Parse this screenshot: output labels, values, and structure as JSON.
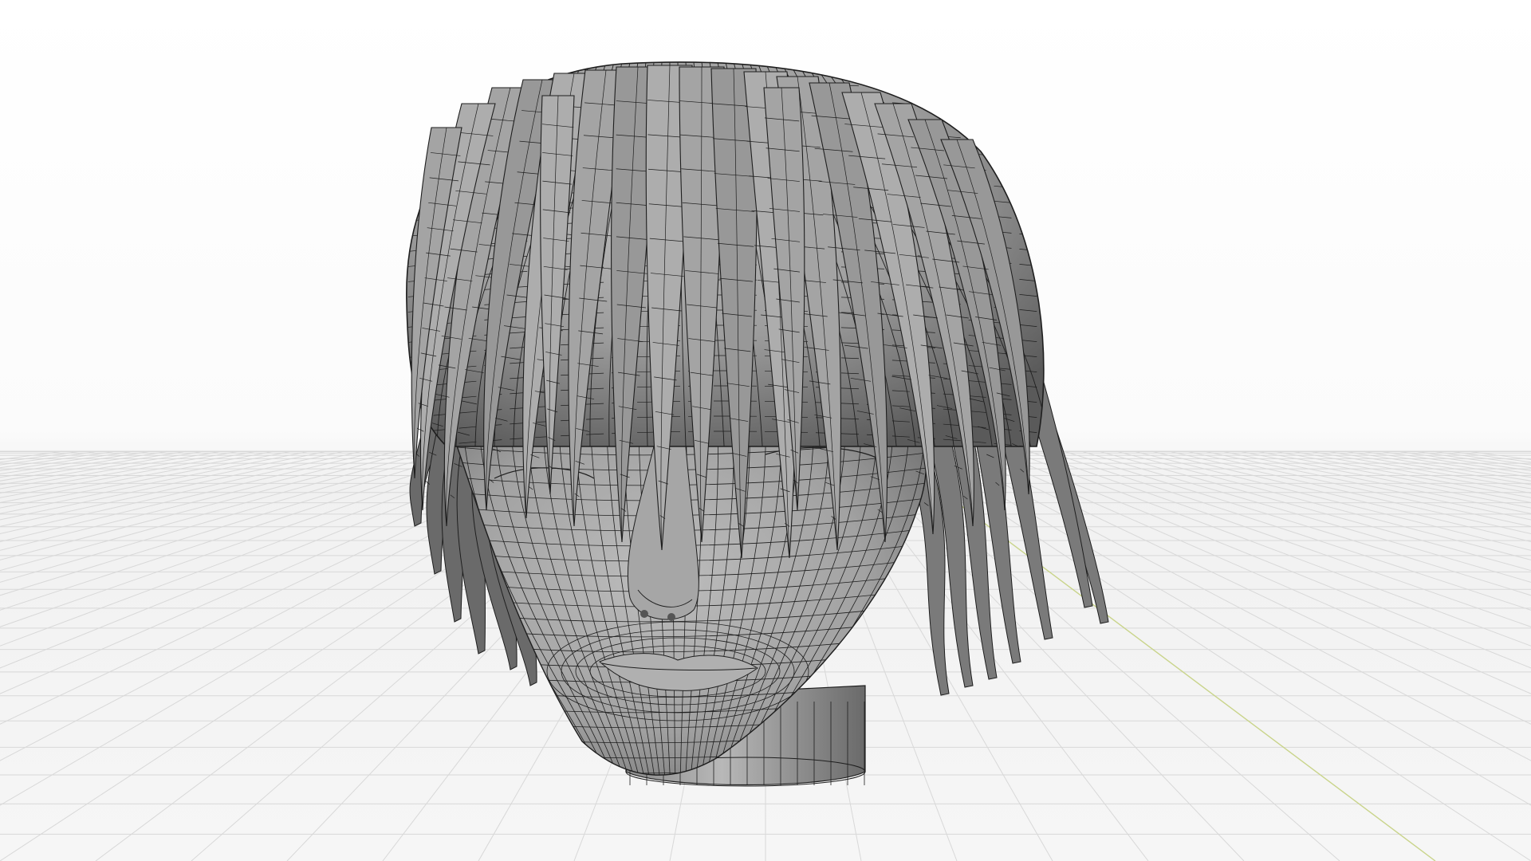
{
  "viewport": {
    "view_mode": "solid-wireframe",
    "subject": "stylized-head-mesh",
    "colors": {
      "background_top": "#ffffff",
      "background_horizon": "#f2f2f2",
      "floor_grid": "#d8d8d8",
      "axis_y": "#c9d48a",
      "mesh_fill": "#9c9c9c",
      "mesh_fill_light": "#c4c4c4",
      "mesh_fill_dark": "#505050",
      "wire": "#1e1e1e"
    }
  }
}
